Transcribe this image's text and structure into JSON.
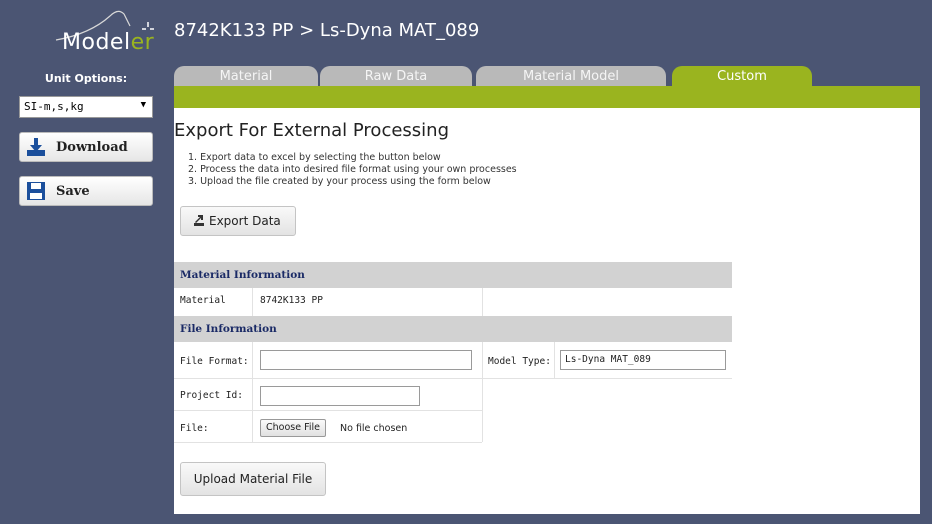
{
  "app": {
    "logo_text": "Model",
    "logo_accent": "er",
    "title": "8742K133 PP > Ls-Dyna MAT_089"
  },
  "sidebar": {
    "unit_label": "Unit Options:",
    "unit_selected": "SI-m,s,kg",
    "download_label": "Download",
    "save_label": "Save"
  },
  "tabs": [
    {
      "label": "Material",
      "active": false
    },
    {
      "label": "Raw Data",
      "active": false
    },
    {
      "label": "Material Model",
      "active": false
    },
    {
      "label": "Custom",
      "active": true
    }
  ],
  "main": {
    "title": "Export For External Processing",
    "steps": [
      "1. Export data to excel by selecting the button below",
      "2. Process the data into desired file format using your own processes",
      "3. Upload the file created by your process using the form below"
    ],
    "export_label": "Export Data",
    "material_section": "Material Information",
    "material_label": "Material",
    "material_value": "8742K133 PP",
    "file_section": "File Information",
    "file_format_label": "File Format:",
    "file_format_value": "",
    "model_type_label": "Model Type:",
    "model_type_value": "Ls-Dyna MAT_089",
    "project_id_label": "Project Id:",
    "project_id_value": "",
    "file_label": "File:",
    "choose_file_label": "Choose File",
    "no_file_text": "No file chosen",
    "upload_label": "Upload Material File"
  },
  "colors": {
    "background": "#4b5573",
    "accent_green": "#9ab41f",
    "tab_inactive": "#b9b9b9",
    "section_header": "#d2d2d2",
    "section_text": "#1a2a66"
  },
  "icons": [
    "download-icon",
    "save-icon",
    "export-icon",
    "dropdown-arrow-icon"
  ]
}
